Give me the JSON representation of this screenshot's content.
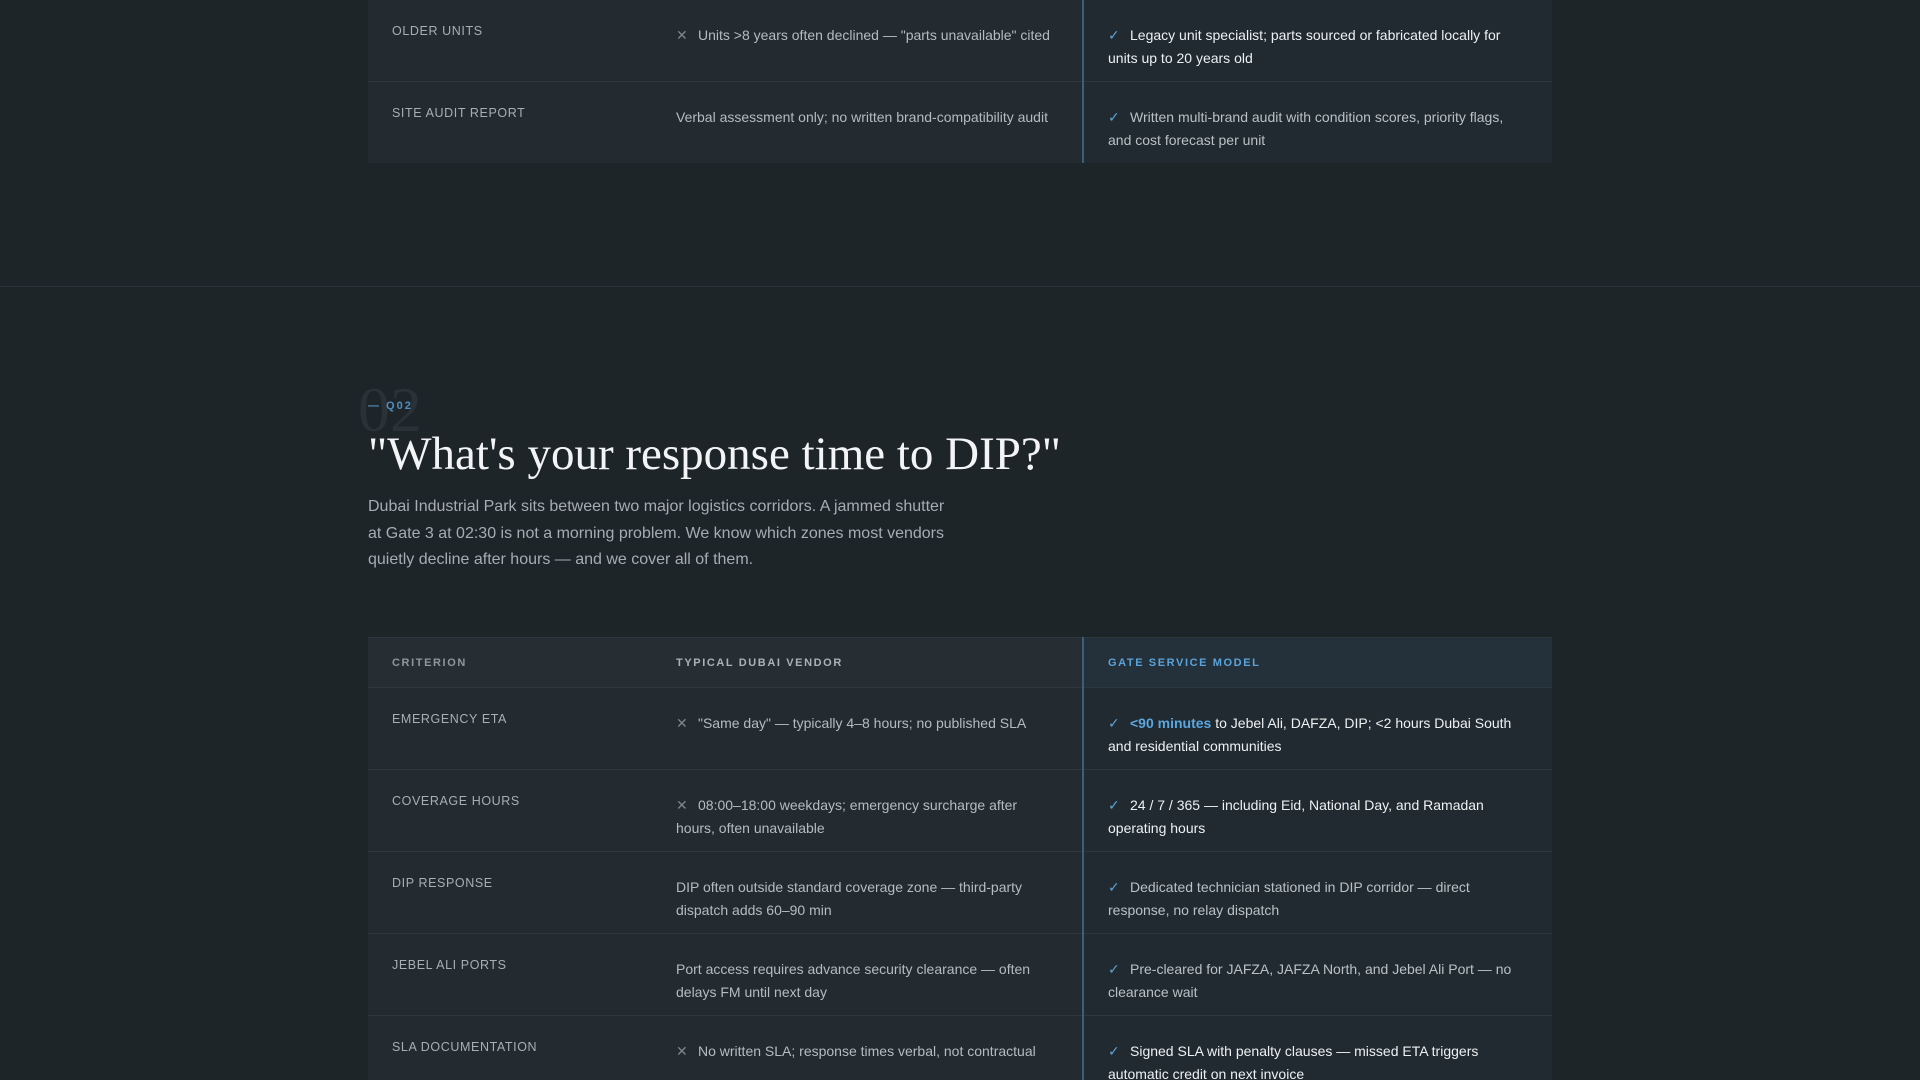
{
  "previous_section": {
    "rows": [
      {
        "criterion": "OLDER UNITS",
        "vendor": "Units >8 years often declined — \"parts unavailable\" cited",
        "vendor_icon": "x-icon",
        "gate": "Legacy unit specialist; parts sourced or fabricated locally for units up to 20 years old",
        "gate_strong": true
      },
      {
        "criterion": "SITE AUDIT REPORT",
        "vendor": "Verbal assessment only; no written brand-compatibility audit",
        "vendor_icon": "",
        "gate": "Written multi-brand audit with condition scores, priority flags, and cost forecast per unit",
        "gate_strong": false
      }
    ]
  },
  "section": {
    "number": "02",
    "eyebrow": "— Q02",
    "title": "\"What's your response time to DIP?\"",
    "intro": "Dubai Industrial Park sits between two major logistics corridors. A jammed shutter at Gate 3 at 02:30 is not a morning problem. We know which zones most vendors quietly decline after hours — and we cover all of them."
  },
  "table": {
    "headers": {
      "criterion": "CRITERION",
      "vendor": "TYPICAL DUBAI VENDOR",
      "gate": "GATE SERVICE MODEL"
    },
    "rows": [
      {
        "criterion": "EMERGENCY ETA",
        "vendor": "\"Same day\" — typically 4–8 hours; no published SLA",
        "vendor_icon": "x-icon",
        "gate_highlight": "<90 minutes",
        "gate": "to Jebel Ali, DAFZA, DIP; <2 hours Dubai South and residential communities",
        "gate_strong": true
      },
      {
        "criterion": "COVERAGE HOURS",
        "vendor": "08:00–18:00 weekdays; emergency surcharge after hours, often unavailable",
        "vendor_icon": "x-icon",
        "gate": "24 / 7 / 365 — including Eid, National Day, and Ramadan operating hours",
        "gate_strong": true
      },
      {
        "criterion": "DIP RESPONSE",
        "vendor": "DIP often outside standard coverage zone — third-party dispatch adds 60–90 min",
        "vendor_icon": "",
        "gate": "Dedicated technician stationed in DIP corridor — direct response, no relay dispatch",
        "gate_strong": false
      },
      {
        "criterion": "JEBEL ALI PORTS",
        "vendor": "Port access requires advance security clearance — often delays FM until next day",
        "vendor_icon": "",
        "gate": "Pre-cleared for JAFZA, JAFZA North, and Jebel Ali Port — no clearance wait",
        "gate_strong": false
      },
      {
        "criterion": "SLA DOCUMENTATION",
        "vendor": "No written SLA; response times verbal, not contractual",
        "vendor_icon": "x-icon",
        "gate": "Signed SLA with penalty clauses — missed ETA triggers automatic credit on next invoice",
        "gate_strong": true
      }
    ]
  },
  "icons": {
    "x": "✕",
    "check": "✓"
  },
  "colors": {
    "background": "#1e2529",
    "accent": "#5aa7e0",
    "divider_accent": "#3a5f7d"
  }
}
